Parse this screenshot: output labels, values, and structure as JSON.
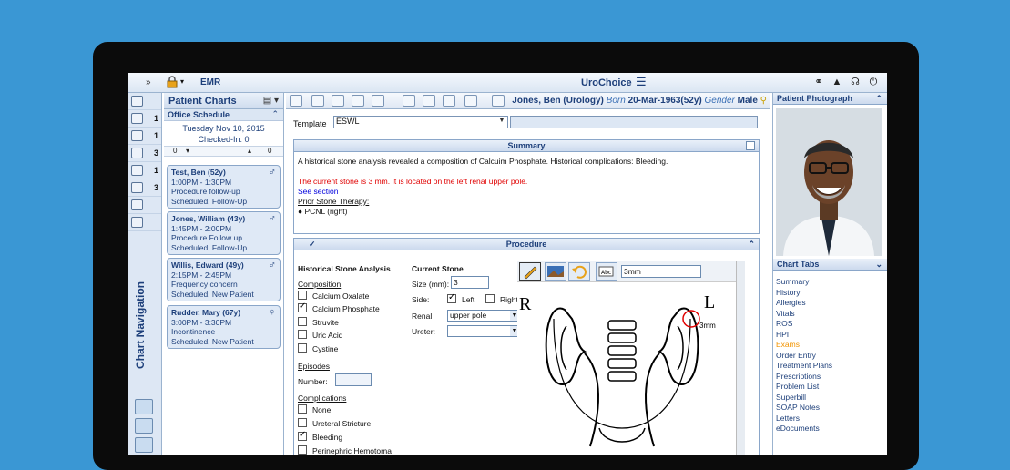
{
  "topbar": {
    "expand": "»",
    "emr_label": "EMR",
    "brand": "UroChoice",
    "menu_glyph": "☰"
  },
  "left_nav": {
    "counts": [
      "",
      "1",
      "1",
      "3",
      "1",
      "3",
      "",
      ""
    ],
    "title": "Chart Navigation"
  },
  "patient_charts": {
    "title": "Patient Charts",
    "schedule_title": "Office Schedule",
    "date": "Tuesday Nov 10, 2015",
    "checked_in": "Checked-In: 0",
    "count_left": "0",
    "count_mid": "0",
    "appointments": [
      {
        "name": "Test, Ben (52y)",
        "time": "1:00PM - 1:30PM",
        "reason": "Procedure follow-up",
        "status": "Scheduled, Follow-Up",
        "gender_glyph": "♂"
      },
      {
        "name": "Jones, William (43y)",
        "time": "1:45PM - 2:00PM",
        "reason": "Procedure Follow up",
        "status": "Scheduled, Follow-Up",
        "gender_glyph": "♂"
      },
      {
        "name": "Willis, Edward (49y)",
        "time": "2:15PM - 2:45PM",
        "reason": "Frequency concern",
        "status": "Scheduled, New Patient",
        "gender_glyph": "♂"
      },
      {
        "name": "Rudder, Mary (67y)",
        "time": "3:00PM - 3:30PM",
        "reason": "Incontinence",
        "status": "Scheduled, New Patient",
        "gender_glyph": "♀"
      }
    ]
  },
  "patient_bar": {
    "name": "Jones, Ben (Urology)",
    "born_label": "Born",
    "born": "20-Mar-1963(52y)",
    "gender_label": "Gender",
    "gender": "Male"
  },
  "template": {
    "label": "Template",
    "value": "ESWL"
  },
  "summary": {
    "title": "Summary",
    "line1": "A historical stone analysis revealed a composition of Calcuim Phosphate. Historical complications: Bleeding.",
    "current": "The current stone is 3 mm. It is located on the left renal upper pole.",
    "see_section": "See section",
    "prior": "Prior Stone Therapy:",
    "bullet": "●  PCNL (right)"
  },
  "procedure": {
    "title": "Procedure",
    "historical_title": "Historical Stone Analysis",
    "composition_title": "Composition",
    "composition": [
      {
        "label": "Calcium Oxalate",
        "checked": false
      },
      {
        "label": "Calcium Phosphate",
        "checked": true
      },
      {
        "label": "Struvite",
        "checked": false
      },
      {
        "label": "Uric Acid",
        "checked": false
      },
      {
        "label": "Cystine",
        "checked": false
      }
    ],
    "episodes_title": "Episodes",
    "number_label": "Number:",
    "complications_title": "Complications",
    "complications": [
      {
        "label": "None",
        "checked": false
      },
      {
        "label": "Ureteral Stricture",
        "checked": false
      },
      {
        "label": "Bleeding",
        "checked": true
      },
      {
        "label": "Perinephric Hemotoma",
        "checked": false
      }
    ],
    "current_title": "Current Stone",
    "size_label": "Size (mm):",
    "size_value": "3",
    "side_label": "Side:",
    "left_label": "Left",
    "right_label": "Right",
    "renal_label": "Renal",
    "renal_value": "upper pole",
    "ureter_label": "Ureter:",
    "annotation_value": "3mm",
    "diagram_R": "R",
    "diagram_L": "L",
    "diagram_note": "3mm"
  },
  "right_panel": {
    "photo_title": "Patient Photograph",
    "tabs_title": "Chart Tabs",
    "tabs": [
      "Summary",
      "History",
      "Allergies",
      "Vitals",
      "ROS",
      "HPI",
      "Exams",
      "Order Entry",
      "Treatment Plans",
      "Prescriptions",
      "Problem List",
      "Superbill",
      "SOAP Notes",
      "Letters",
      "eDocuments"
    ],
    "active_tab": "Exams"
  },
  "colors": {
    "background": "#3a97d4",
    "accent": "#1d3f7a",
    "alert_red": "#e00000",
    "active_tab": "#f29400"
  }
}
